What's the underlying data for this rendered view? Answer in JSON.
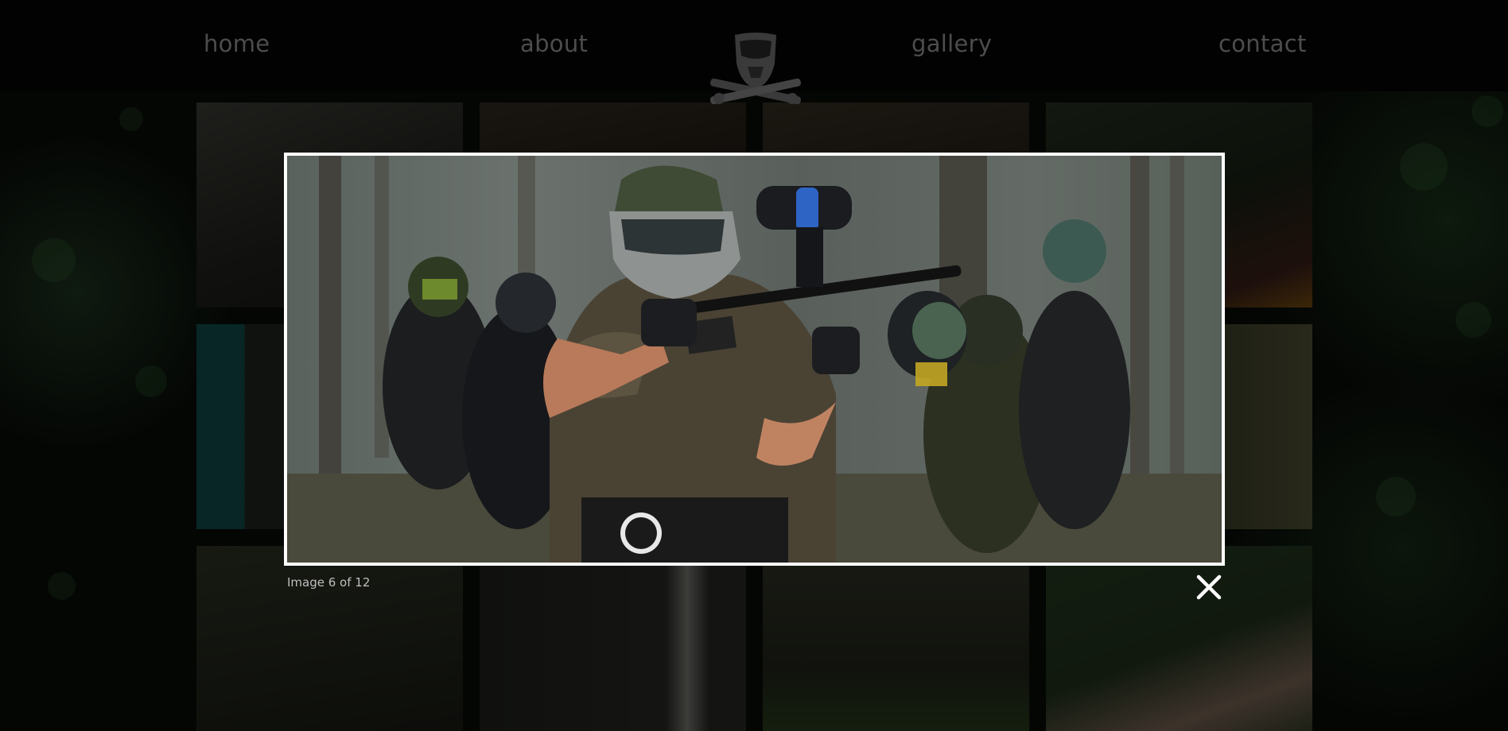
{
  "nav": {
    "home": "home",
    "about": "about",
    "gallery": "gallery",
    "contact": "contact"
  },
  "lightbox": {
    "caption": "Image 6 of 12"
  },
  "icons": {
    "logo": "paintball-mask-crossed-markers-logo",
    "close": "close-icon"
  },
  "colors": {
    "background": "#050505",
    "nav_text": "#4d4d4d",
    "frame_border": "#ffffff",
    "caption_text": "#bfbfbf"
  }
}
